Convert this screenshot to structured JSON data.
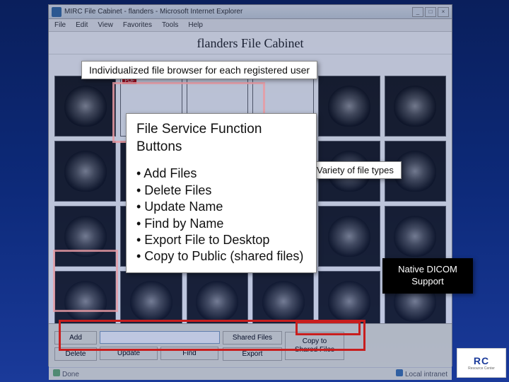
{
  "window": {
    "title": "MIRC File Cabinet - flanders - Microsoft Internet Explorer",
    "min": "_",
    "max": "□",
    "close": "×"
  },
  "menu": {
    "file": "File",
    "edit": "Edit",
    "view": "View",
    "favorites": "Favorites",
    "tools": "Tools",
    "help": "Help"
  },
  "page": {
    "title": "flanders File Cabinet"
  },
  "annotations": {
    "top": "Individualized file browser for each registered user",
    "side": "Variety of file types",
    "dicom_l1": "Native DICOM",
    "dicom_l2": "Support",
    "func_header": "File Service Function Buttons",
    "func_items": [
      "Add Files",
      "Delete Files",
      "Update Name",
      "Find by Name",
      "Export File to Desktop",
      "Copy to Public (shared files)"
    ]
  },
  "toolbar": {
    "add": "Add",
    "delete": "Delete",
    "update": "Update",
    "find": "Find",
    "shared": "Shared Files",
    "export": "Export",
    "copy_l1": "Copy to",
    "copy_l2": "Shared Files"
  },
  "status": {
    "done": "Done",
    "zone": "Local intranet"
  },
  "logo": {
    "text": "RC",
    "sub": "Resource Center"
  }
}
